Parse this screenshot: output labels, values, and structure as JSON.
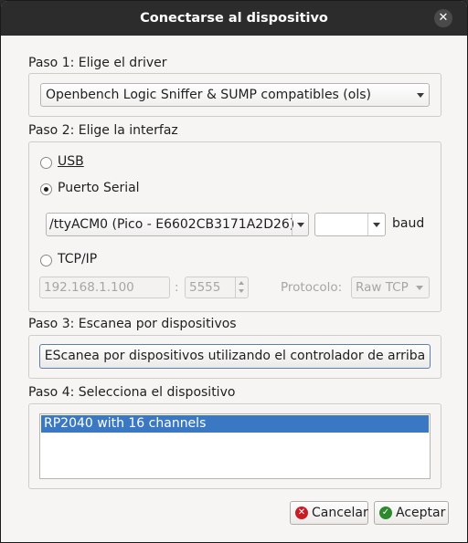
{
  "window": {
    "title": "Conectarse al dispositivo",
    "close_glyph": "✕"
  },
  "step1": {
    "label": "Paso 1: Elige el driver",
    "driver": "Openbench Logic Sniffer & SUMP compatibles (ols)"
  },
  "step2": {
    "label": "Paso 2: Elige la interfaz",
    "usb_label": "USB",
    "serial_label": "Puerto Serial",
    "serial_port": "/ttyACM0 (Pico - E6602CB3171A2D26)",
    "baud_value": "",
    "baud_unit": "baud",
    "tcp_label": "TCP/IP",
    "ip_placeholder": "192.168.1.100",
    "port_sep": ":",
    "port_value": "5555",
    "protocol_label": "Protocolo:",
    "protocol_value": "Raw TCP",
    "selected": "serial"
  },
  "step3": {
    "label": "Paso 3: Escanea por dispositivos",
    "scan_button": "EScanea por dispositivos utilizando el controlador de arriba"
  },
  "step4": {
    "label": "Paso 4: Selecciona el dispositivo",
    "devices": [
      "RP2040 with 16 channels"
    ]
  },
  "buttons": {
    "cancel": "Cancelar",
    "accept": "Aceptar"
  },
  "icons": {
    "close": "close-icon",
    "cancel": "cancel-icon",
    "accept": "check-icon",
    "dropdown": "chevron-down-icon"
  },
  "colors": {
    "titlebar": "#2c2c2c",
    "selection": "#3b78c4",
    "cancel_icon": "#c81d25",
    "accept_icon": "#2c8a2c"
  }
}
